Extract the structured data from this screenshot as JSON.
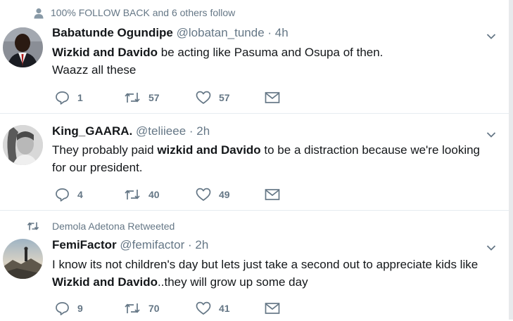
{
  "tweets": [
    {
      "social_context": "100% FOLLOW BACK and 6 others follow",
      "social_icon": "person-icon",
      "name": "Babatunde Ogundipe",
      "handle": "@lobatan_tunde",
      "time": "4h",
      "text_parts": [
        {
          "t": "Wizkid and Davido",
          "b": true
        },
        {
          "t": " be acting like Pasuma and Osupa of then.",
          "b": false
        },
        {
          "t": "Waazz all these",
          "b": false
        }
      ],
      "replies": "1",
      "retweets": "57",
      "likes": "57"
    },
    {
      "name": "King_GAARA.",
      "handle": "@teliieee",
      "time": "2h",
      "text_parts": [
        {
          "t": "They probably paid ",
          "b": false
        },
        {
          "t": "wizkid and Davido",
          "b": true
        },
        {
          "t": " to be a distraction because we're looking",
          "b": false
        },
        {
          "t": "for our president.",
          "b": false
        }
      ],
      "replies": "4",
      "retweets": "40",
      "likes": "49"
    },
    {
      "social_context": "Demola Adetona Retweeted",
      "social_icon": "retweet-icon",
      "name": "FemiFactor",
      "handle": "@femifactor",
      "time": "2h",
      "text_parts": [
        {
          "t": "I know its not children's day but lets just take a second out to appreciate kids like",
          "b": false
        },
        {
          "t": "Wizkid and Davido",
          "b": true
        },
        {
          "t": "..they will grow up some day",
          "b": false
        }
      ],
      "replies": "9",
      "retweets": "70",
      "likes": "41"
    }
  ],
  "dot": "·",
  "colors": {
    "muted": "#657786",
    "text": "#14171a",
    "divider": "#e6ecf0"
  }
}
